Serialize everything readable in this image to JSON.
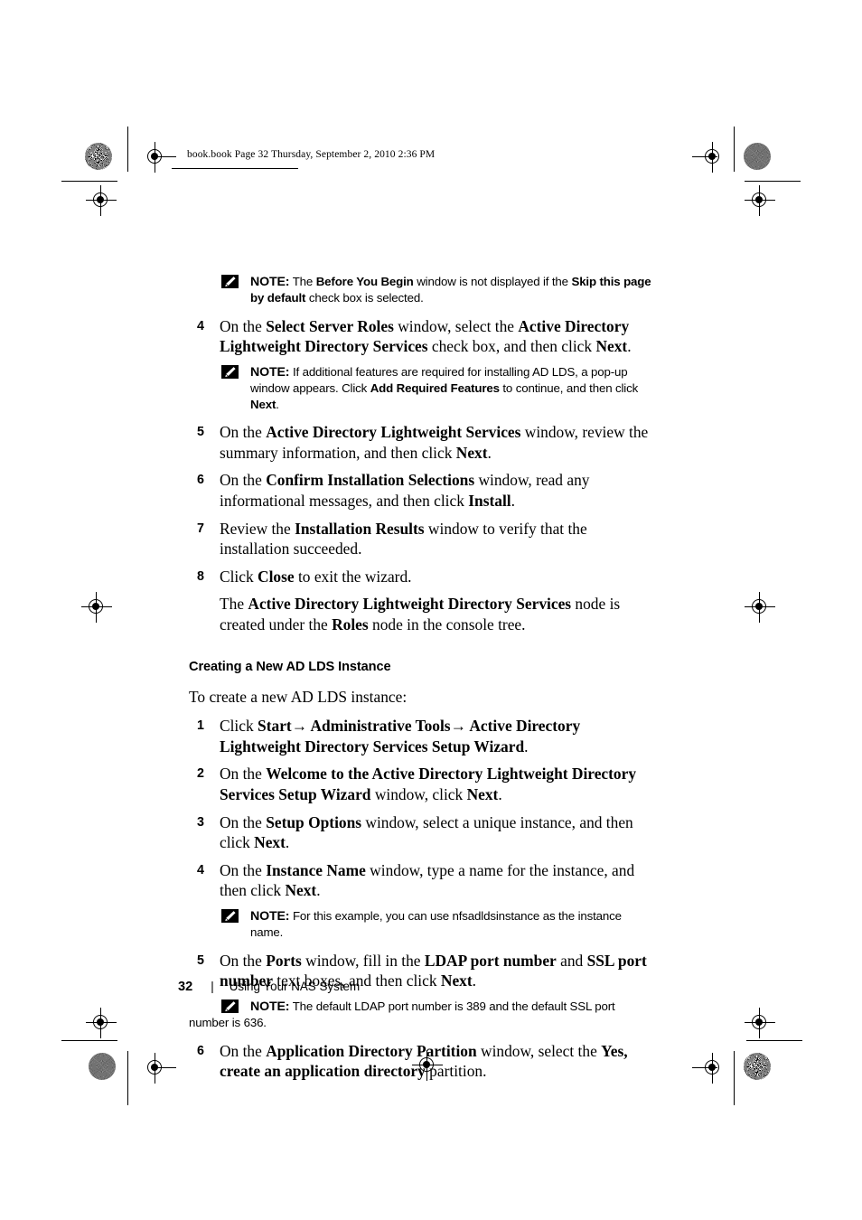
{
  "page": {
    "file_header": "book.book  Page 32  Thursday, September 2, 2010  2:36 PM",
    "number": "32",
    "separator": "|",
    "footer_title": "Using Your NAS System"
  },
  "note_label": "NOTE:",
  "notes": {
    "before_you_begin": {
      "t1": "The ",
      "b1": "Before You Begin",
      "t2": " window is not displayed if the ",
      "b2": "Skip this page by default",
      "t3": " check box is selected."
    },
    "additional_features": {
      "t1": "If additional features are required for installing AD LDS, a pop-up window appears. Click ",
      "b1": "Add Required Features",
      "t2": " to continue, and then click ",
      "b2": "Next",
      "t3": "."
    },
    "instance_example": {
      "t1": "For this example, you can use nfsadldsinstance as the instance name."
    },
    "default_ports": {
      "t1": "The default LDAP port number is 389 and the default SSL port number is 636."
    }
  },
  "install_steps": [
    {
      "num": "4",
      "t1": "On the ",
      "b1": "Select Server Roles",
      "t2": " window, select the ",
      "b2": "Active Directory Lightweight Directory Services",
      "t3": " check box, and then click ",
      "b3": "Next",
      "t4": "."
    },
    {
      "num": "5",
      "t1": "On the ",
      "b1": "Active Directory Lightweight Services",
      "t2": " window, review the summary information, and then click ",
      "b2": "Next",
      "t3": "."
    },
    {
      "num": "6",
      "t1": "On the ",
      "b1": "Confirm Installation Selections",
      "t2": " window, read any informational messages, and then click ",
      "b2": "Install",
      "t3": "."
    },
    {
      "num": "7",
      "t1": "Review the ",
      "b1": "Installation Results",
      "t2": " window to verify that the installation succeeded.",
      "b2": "",
      "t3": ""
    },
    {
      "num": "8",
      "t1": "Click ",
      "b1": "Close",
      "t2": " to exit the wizard.",
      "b2": "",
      "t3": ""
    }
  ],
  "node_created_para": {
    "t1": "The ",
    "b1": "Active Directory Lightweight Directory Services",
    "t2": " node is created under the ",
    "b2": "Roles",
    "t3": " node in the console tree."
  },
  "subheading": "Creating a New AD LDS Instance",
  "intro_line": "To create a new AD LDS instance:",
  "instance_steps": [
    {
      "num": "1",
      "t1": "Click ",
      "b1": "Start→ Administrative Tools→ Active Directory Lightweight Directory Services Setup Wizard",
      "t2": ".",
      "b2": "",
      "t3": "",
      "b3": "",
      "t4": ""
    },
    {
      "num": "2",
      "t1": "On the ",
      "b1": "Welcome to the Active Directory Lightweight Directory Services Setup Wizard",
      "t2": " window, click ",
      "b2": "Next",
      "t3": ".",
      "b3": "",
      "t4": ""
    },
    {
      "num": "3",
      "t1": "On the ",
      "b1": "Setup Options",
      "t2": " window, select a unique instance, and then click ",
      "b2": "Next",
      "t3": ".",
      "b3": "",
      "t4": ""
    },
    {
      "num": "4",
      "t1": "On the ",
      "b1": "Instance Name",
      "t2": " window, type a name for the instance, and then click ",
      "b2": "Next",
      "t3": ".",
      "b3": "",
      "t4": ""
    },
    {
      "num": "5",
      "t1": "On the ",
      "b1": "Ports",
      "t2": " window, fill in the ",
      "b2": "LDAP port number",
      "t3": " and ",
      "b3": "SSL port number",
      "t4": " text boxes, and then click "
    },
    {
      "num": "6",
      "t1": "On the ",
      "b1": "Application Directory Partition",
      "t2": " window, select the ",
      "b2": "Yes, create an application directory",
      "t3": " partition.",
      "b3": "",
      "t4": ""
    }
  ],
  "step5_tail_bold": "Next",
  "step5_tail_text": "."
}
